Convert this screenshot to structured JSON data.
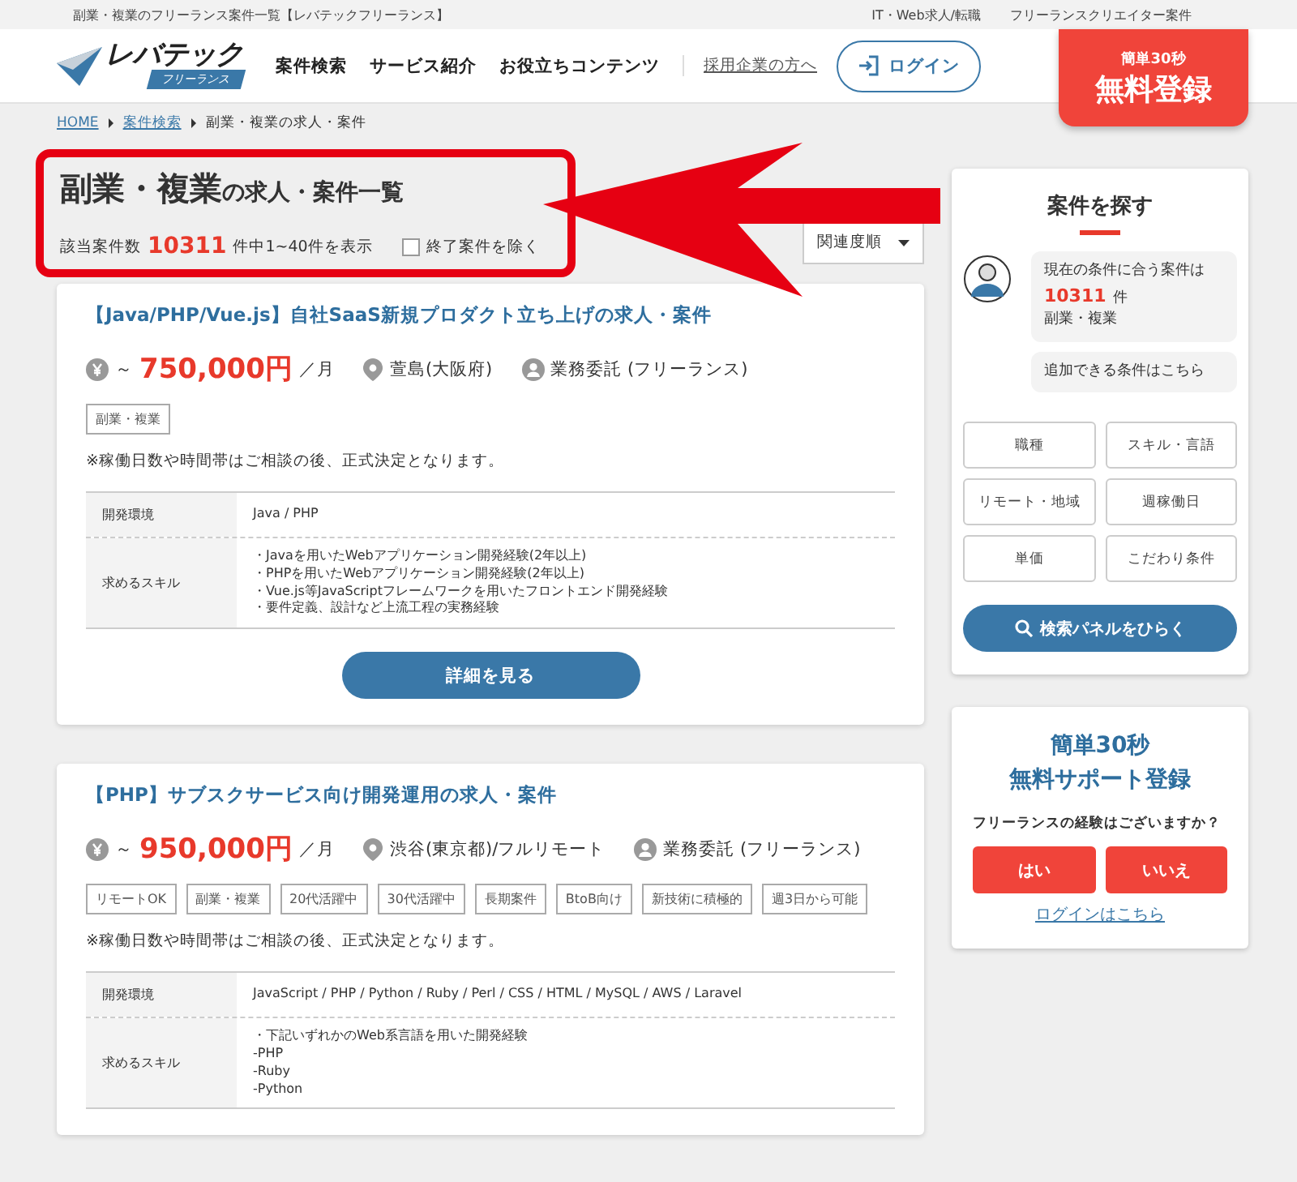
{
  "top_bar": {
    "title": "副業・複業のフリーランス案件一覧【レバテックフリーランス】",
    "links": [
      "IT・Web求人/転職",
      "フリーランスクリエイター案件"
    ]
  },
  "header": {
    "logo": {
      "main": "レバテック",
      "sub": "フリーランス"
    },
    "nav": [
      "案件検索",
      "サービス紹介",
      "お役立ちコンテンツ"
    ],
    "corporate_link": "採用企業の方へ",
    "login": "ログイン",
    "register": {
      "small": "簡単30秒",
      "big": "無料登録"
    }
  },
  "breadcrumb": [
    {
      "label": "HOME",
      "link": true
    },
    {
      "label": "案件検索",
      "link": true
    },
    {
      "label": "副業・複業の求人・案件",
      "link": false
    }
  ],
  "heading": {
    "title": "**副業・複業**の求人・案件一覧",
    "count_prefix": "該当案件数",
    "count": "10311",
    "count_suffix": "件中1~40件を表示",
    "exclude_closed": {
      "label": "終了案件を除く",
      "checked": false
    },
    "sort": "関連度順"
  },
  "jobs": [
    {
      "title": "【Java/PHP/Vue.js】自社SaaS新規プロダクト立ち上げの求人・案件",
      "price_prefix": "～",
      "price": "750,000円",
      "price_unit": "／月",
      "location": "萱島(大阪府)",
      "contract": "業務委託 (フリーランス)",
      "tags": [
        "副業・複業"
      ],
      "note": "※稼働日数や時間帯はご相談の後、正式決定となります。",
      "details": [
        {
          "label": "開発環境",
          "lines": [
            "Java / PHP"
          ]
        },
        {
          "label": "求めるスキル",
          "lines": [
            "・Javaを用いたWebアプリケーション開発経験(2年以上)",
            "・PHPを用いたWebアプリケーション開発経験(2年以上)",
            "・Vue.js等JavaScriptフレームワークを用いたフロントエンド開発経験",
            "・要件定義、設計など上流工程の実務経験"
          ]
        }
      ],
      "button": "詳細を見る"
    },
    {
      "title": "【PHP】サブスクサービス向け開発運用の求人・案件",
      "price_prefix": "～",
      "price": "950,000円",
      "price_unit": "／月",
      "location": "渋谷(東京都)/フルリモート",
      "contract": "業務委託 (フリーランス)",
      "tags": [
        "リモートOK",
        "副業・複業",
        "20代活躍中",
        "30代活躍中",
        "長期案件",
        "BtoB向け",
        "新技術に積極的",
        "週3日から可能"
      ],
      "note": "※稼働日数や時間帯はご相談の後、正式決定となります。",
      "details": [
        {
          "label": "開発環境",
          "lines": [
            "JavaScript / PHP / Python / Ruby / Perl / CSS / HTML / MySQL / AWS / Laravel"
          ]
        },
        {
          "label": "求めるスキル",
          "lines": [
            "・下記いずれかのWeb系言語を用いた開発経験",
            "-PHP",
            "-Ruby",
            "-Python"
          ]
        }
      ]
    }
  ],
  "search_panel": {
    "title": "案件を探す",
    "bubble": {
      "line1": "現在の条件に合う案件は",
      "count": "10311",
      "unit": "件",
      "condition": "副業・複業"
    },
    "add_conditions": "追加できる条件はこちら",
    "filters": [
      "職種",
      "スキル・言語",
      "リモート・地域",
      "週稼働日",
      "単価",
      "こだわり条件"
    ],
    "open_button": "検索パネルをひらく"
  },
  "support": {
    "title_line1": "簡単30秒",
    "title_line2": "無料サポート登録",
    "question": "フリーランスの経験はございますか？",
    "answers": [
      "はい",
      "いいえ"
    ],
    "login_link": "ログインはこちら"
  }
}
